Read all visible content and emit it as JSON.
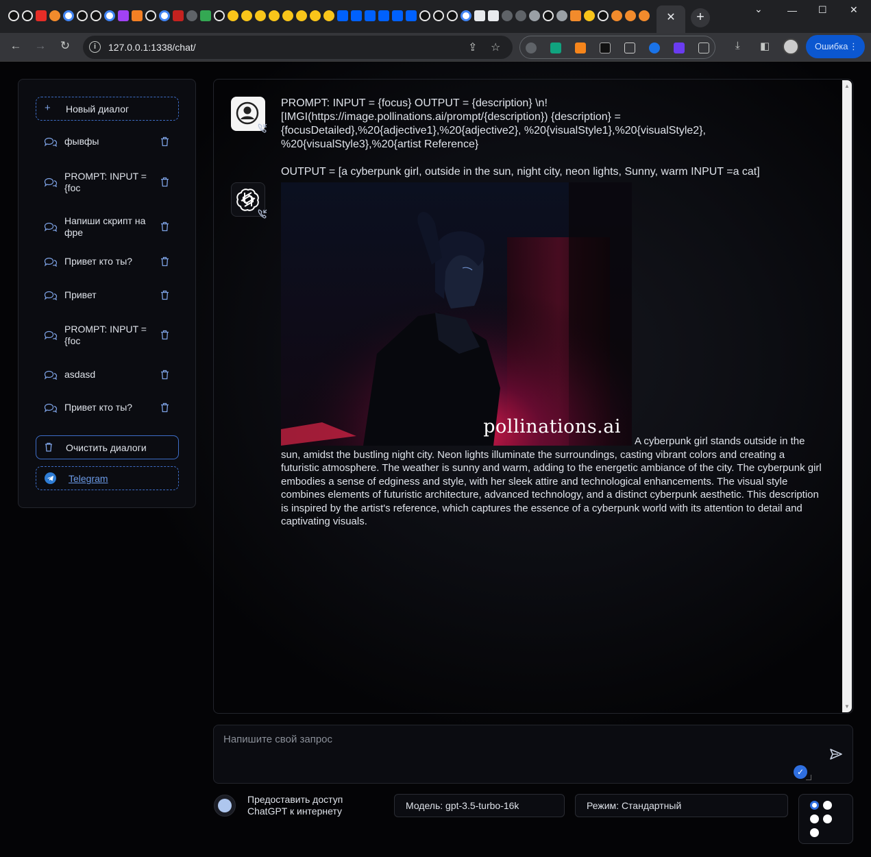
{
  "browser": {
    "active_tab_close": "✕",
    "new_tab": "+",
    "url": "127.0.0.1:1338/chat/",
    "error_button": "Ошибка"
  },
  "sidebar": {
    "new_dialog": "Новый диалог",
    "conversations": [
      {
        "label": "фывфы"
      },
      {
        "label": "PROMPT: INPUT = {foc"
      },
      {
        "label": "Напиши скрипт на фре"
      },
      {
        "label": "Привет кто ты?"
      },
      {
        "label": "Привет"
      },
      {
        "label": "PROMPT: INPUT = {foc"
      },
      {
        "label": "asdasd"
      },
      {
        "label": "Привет кто ты?"
      }
    ],
    "clear_dialogs": "Очистить диалоги",
    "telegram": "Telegram"
  },
  "chat": {
    "user_message": "PROMPT: INPUT = {focus} OUTPUT = {description} \\n!\n[IMGI(https://image.pollinations.ai/prompt/{description}) {description} = {focusDetailed},%20{adjective1},%20{adjective2}, %20{visualStyle1},%20{visualStyle2}, %20{visualStyle3},%20{artist Reference}\n\nOUTPUT = [a cyberpunk girl, outside in the sun, night city, neon lights, Sunny, warm INPUT =a cat]",
    "image_watermark": "pollinations.ai",
    "assistant_reply": "A cyberpunk girl stands outside in the sun, amidst the bustling night city. Neon lights illuminate the surroundings, casting vibrant colors and creating a futuristic atmosphere. The weather is sunny and warm, adding to the energetic ambiance of the city. The cyberpunk girl embodies a sense of edginess and style, with her sleek attire and technological enhancements. The visual style combines elements of futuristic architecture, advanced technology, and a distinct cyberpunk aesthetic. This description is inspired by the artist's reference, which captures the essence of a cyberpunk world with its attention to detail and captivating visuals."
  },
  "input": {
    "placeholder": "Напишите свой запрос"
  },
  "options": {
    "internet_toggle": "Предоставить доступ ChatGPT к интернету",
    "model_select": "Модель: gpt-3.5-turbo-16k",
    "mode_select": "Режим: Стандартный"
  },
  "colors": {
    "accent": "#3e6ec8",
    "page_bg": "#0c0d12",
    "text": "#dfe3ea"
  },
  "icons": [
    "plus-icon",
    "chat-icon",
    "trash-icon",
    "telegram-icon",
    "user-icon",
    "openai-icon",
    "call-icon",
    "send-icon",
    "check-icon"
  ]
}
